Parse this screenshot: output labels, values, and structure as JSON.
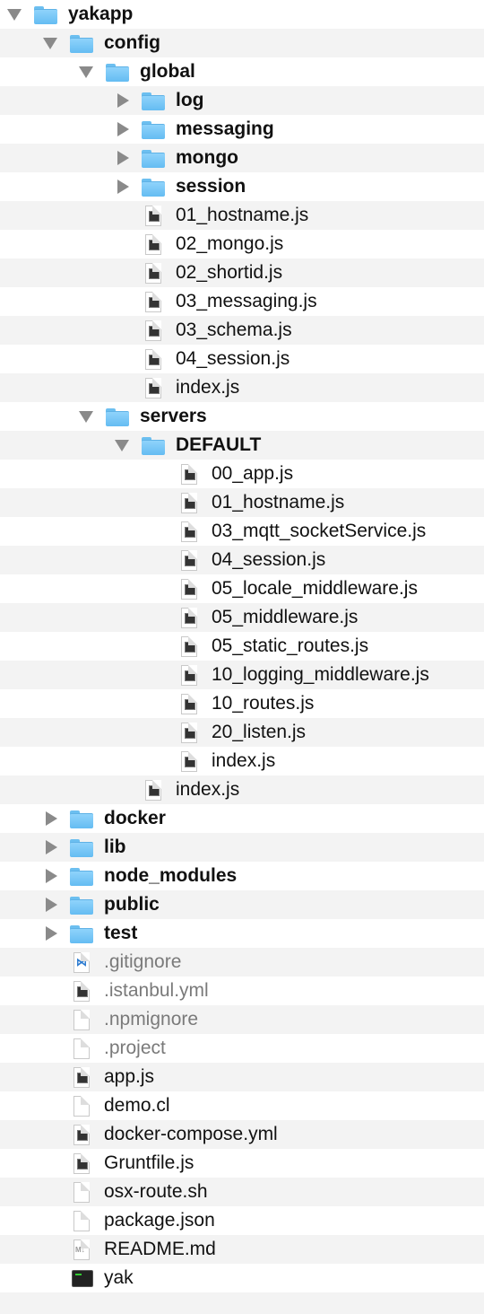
{
  "items": [
    {
      "name": "yakapp",
      "depth": 0,
      "type": "folder",
      "expanded": true
    },
    {
      "name": "config",
      "depth": 1,
      "type": "folder",
      "expanded": true
    },
    {
      "name": "global",
      "depth": 2,
      "type": "folder",
      "expanded": true
    },
    {
      "name": "log",
      "depth": 3,
      "type": "folder",
      "expanded": false
    },
    {
      "name": "messaging",
      "depth": 3,
      "type": "folder",
      "expanded": false
    },
    {
      "name": "mongo",
      "depth": 3,
      "type": "folder",
      "expanded": false
    },
    {
      "name": "session",
      "depth": 3,
      "type": "folder",
      "expanded": false
    },
    {
      "name": "01_hostname.js",
      "depth": 3,
      "type": "js"
    },
    {
      "name": "02_mongo.js",
      "depth": 3,
      "type": "js"
    },
    {
      "name": "02_shortid.js",
      "depth": 3,
      "type": "js"
    },
    {
      "name": "03_messaging.js",
      "depth": 3,
      "type": "js"
    },
    {
      "name": "03_schema.js",
      "depth": 3,
      "type": "js"
    },
    {
      "name": "04_session.js",
      "depth": 3,
      "type": "js"
    },
    {
      "name": "index.js",
      "depth": 3,
      "type": "js"
    },
    {
      "name": "servers",
      "depth": 2,
      "type": "folder",
      "expanded": true
    },
    {
      "name": "DEFAULT",
      "depth": 3,
      "type": "folder",
      "expanded": true
    },
    {
      "name": "00_app.js",
      "depth": 4,
      "type": "js"
    },
    {
      "name": "01_hostname.js",
      "depth": 4,
      "type": "js"
    },
    {
      "name": "03_mqtt_socketService.js",
      "depth": 4,
      "type": "js"
    },
    {
      "name": "04_session.js",
      "depth": 4,
      "type": "js"
    },
    {
      "name": "05_locale_middleware.js",
      "depth": 4,
      "type": "js"
    },
    {
      "name": "05_middleware.js",
      "depth": 4,
      "type": "js"
    },
    {
      "name": "05_static_routes.js",
      "depth": 4,
      "type": "js"
    },
    {
      "name": "10_logging_middleware.js",
      "depth": 4,
      "type": "js"
    },
    {
      "name": "10_routes.js",
      "depth": 4,
      "type": "js"
    },
    {
      "name": "20_listen.js",
      "depth": 4,
      "type": "js"
    },
    {
      "name": "index.js",
      "depth": 4,
      "type": "js"
    },
    {
      "name": "index.js",
      "depth": 3,
      "type": "js"
    },
    {
      "name": "docker",
      "depth": 1,
      "type": "folder",
      "expanded": false
    },
    {
      "name": "lib",
      "depth": 1,
      "type": "folder",
      "expanded": false
    },
    {
      "name": "node_modules",
      "depth": 1,
      "type": "folder",
      "expanded": false
    },
    {
      "name": "public",
      "depth": 1,
      "type": "folder",
      "expanded": false
    },
    {
      "name": "test",
      "depth": 1,
      "type": "folder",
      "expanded": false
    },
    {
      "name": ".gitignore",
      "depth": 1,
      "type": "vscode",
      "hidden": true
    },
    {
      "name": ".istanbul.yml",
      "depth": 1,
      "type": "js",
      "hidden": true
    },
    {
      "name": ".npmignore",
      "depth": 1,
      "type": "blank",
      "hidden": true
    },
    {
      "name": ".project",
      "depth": 1,
      "type": "blank",
      "hidden": true
    },
    {
      "name": "app.js",
      "depth": 1,
      "type": "js"
    },
    {
      "name": "demo.cl",
      "depth": 1,
      "type": "blank"
    },
    {
      "name": "docker-compose.yml",
      "depth": 1,
      "type": "js"
    },
    {
      "name": "Gruntfile.js",
      "depth": 1,
      "type": "js"
    },
    {
      "name": "osx-route.sh",
      "depth": 1,
      "type": "blank"
    },
    {
      "name": "package.json",
      "depth": 1,
      "type": "blank"
    },
    {
      "name": "README.md",
      "depth": 1,
      "type": "markdown"
    },
    {
      "name": "yak",
      "depth": 1,
      "type": "terminal"
    }
  ]
}
